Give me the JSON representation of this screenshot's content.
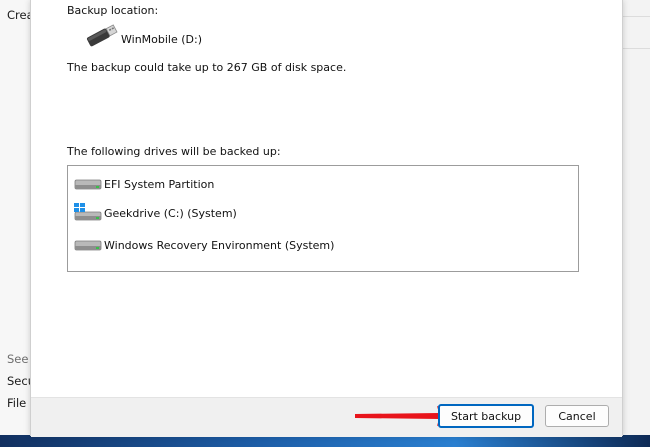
{
  "background_window": {
    "top_text": "Crea",
    "bottom_items": [
      "See a",
      "Secu",
      "File h"
    ]
  },
  "dialog": {
    "backup_location_label": "Backup location:",
    "location_drive": "WinMobile (D:)",
    "space_text": "The backup could take up to 267 GB of disk space.",
    "drives_label": "The following drives will be backed up:",
    "drives": [
      {
        "name": "EFI System Partition",
        "icon": "hard-drive-icon"
      },
      {
        "name": "Geekdrive (C:) (System)",
        "icon": "windows-drive-icon"
      },
      {
        "name": "Windows Recovery Environment (System)",
        "icon": "hard-drive-icon"
      }
    ],
    "buttons": {
      "start_backup": "Start backup",
      "cancel": "Cancel"
    }
  },
  "colors": {
    "accent": "#0067c0",
    "arrow": "#e8141b",
    "drive_led": "#39c04a",
    "windows_logo": "#1e90e8"
  },
  "icons": {
    "usb": "usb-drive-icon",
    "arrow": "red-arrow-icon"
  }
}
